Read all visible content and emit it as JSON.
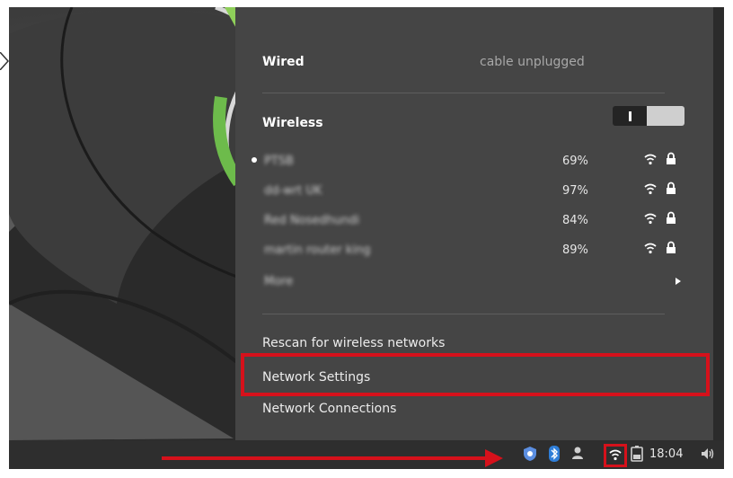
{
  "wired": {
    "title": "Wired",
    "status": "cable unplugged"
  },
  "wireless": {
    "title": "Wireless",
    "toggle_on": true,
    "networks": [
      {
        "name": "PTSB",
        "signal": "69%",
        "connected": true,
        "secured": true
      },
      {
        "name": "dd-wrt UK",
        "signal": "97%",
        "connected": false,
        "secured": true
      },
      {
        "name": "Red Nosedhundi",
        "signal": "84%",
        "connected": false,
        "secured": true
      },
      {
        "name": "martin router king",
        "signal": "89%",
        "connected": false,
        "secured": true
      }
    ],
    "more_label": "More"
  },
  "actions": {
    "rescan": "Rescan for wireless networks",
    "settings": "Network Settings",
    "connections": "Network Connections"
  },
  "panel": {
    "clock": "18:04",
    "tray_icons": [
      "shield-icon",
      "bluetooth-icon",
      "user-icon",
      "wifi-icon",
      "battery-icon",
      "volume-icon"
    ]
  },
  "colors": {
    "menu_bg": "#454545",
    "panel_bg": "#2e2e2e",
    "highlight": "#d6111b"
  }
}
